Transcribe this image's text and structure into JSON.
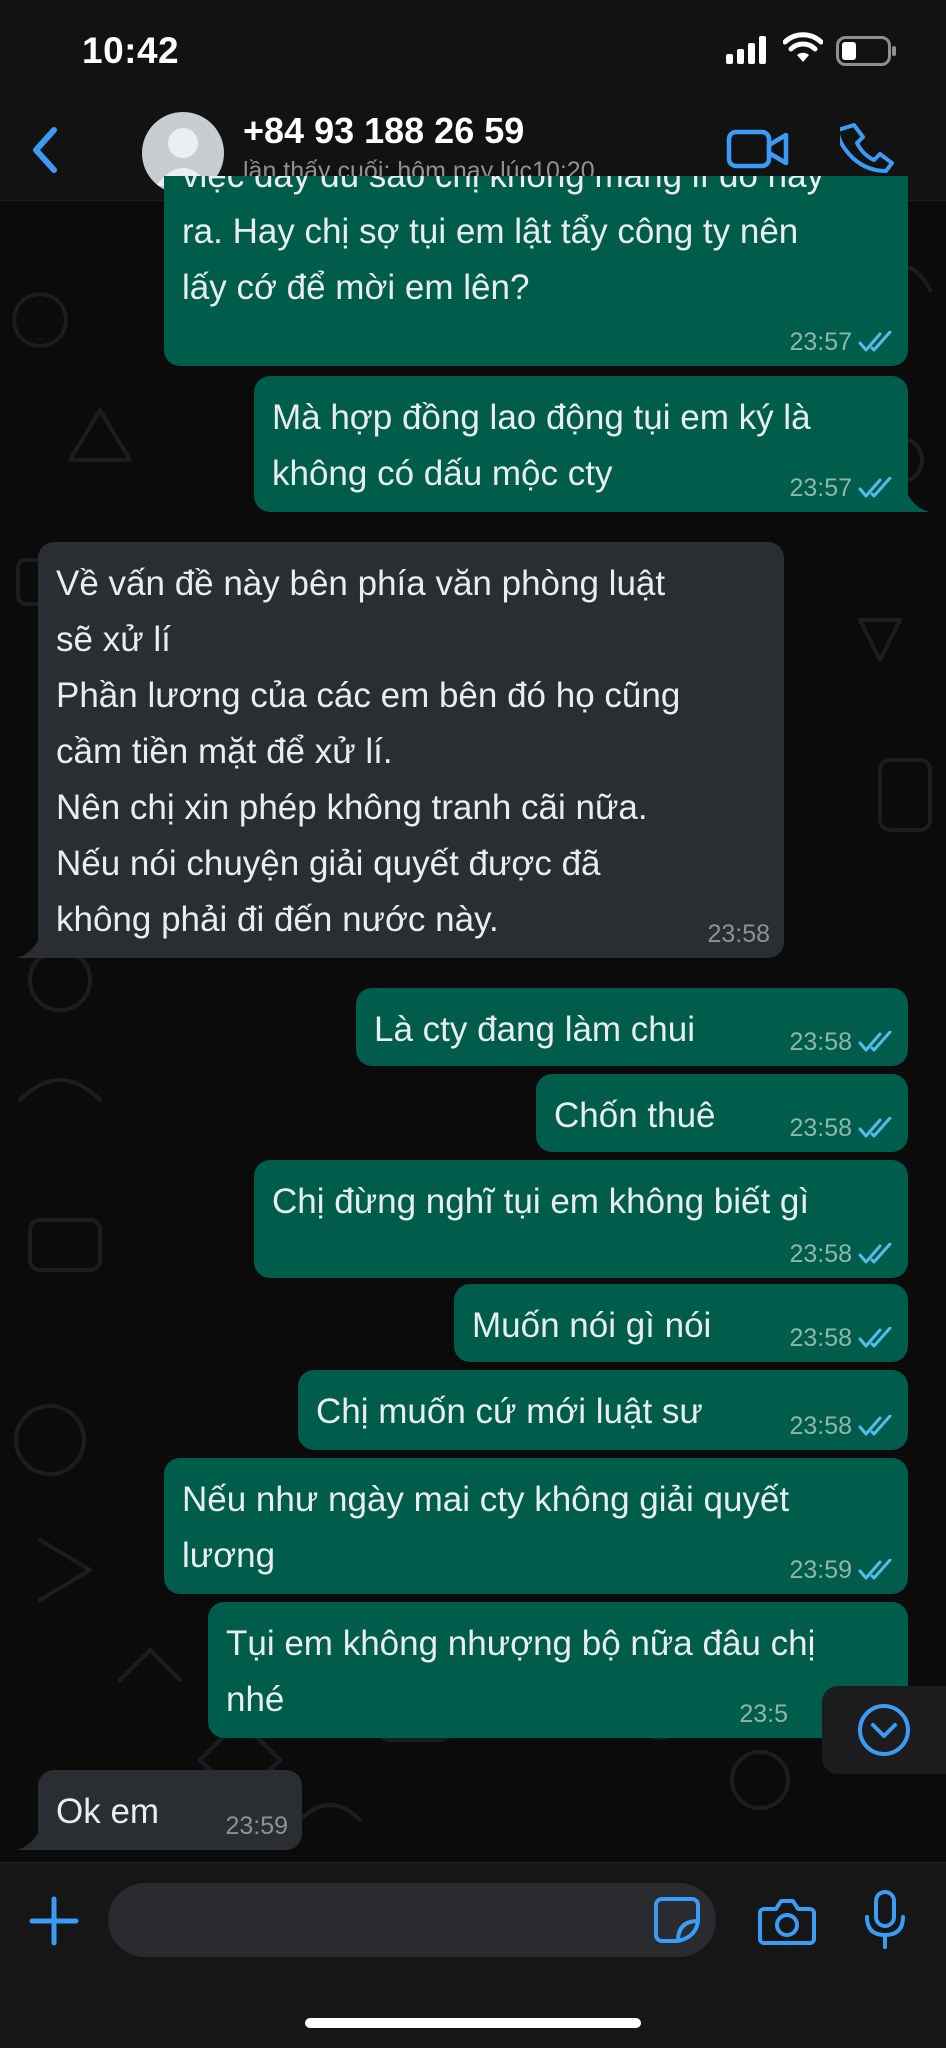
{
  "status_bar": {
    "time": "10:42"
  },
  "header": {
    "contact_name": "+84 93 188 26 59",
    "last_seen": "lần thấy cuối: hôm nay lúc10:20"
  },
  "colors": {
    "accent": "#3b9cf5",
    "outgoing_bubble": "#005c4b",
    "incoming_bubble": "#2a2d31",
    "read_ticks": "#53bdeb"
  },
  "messages": [
    {
      "direction": "out",
      "text": "việc đầy đủ sao chị không mang lí do hay\nra. Hay chị sợ tụi em lật tẩy công ty nên\nlấy cớ để mời em lên?",
      "time": "23:57",
      "status": "read"
    },
    {
      "direction": "out",
      "text": "Mà hợp đồng lao động tụi em ký là\nkhông có dấu mộc cty",
      "time": "23:57",
      "status": "read"
    },
    {
      "direction": "in",
      "text": "Về vấn đề này bên phía văn phòng luật\nsẽ xử lí\nPhần lương của các em bên đó họ cũng\ncầm tiền mặt để xử lí.\nNên chị xin phép không tranh cãi nữa.\nNếu nói chuyện giải quyết được đã\nkhông phải đi đến nước này.",
      "time": "23:58"
    },
    {
      "direction": "out",
      "text": "Là cty đang làm chui",
      "time": "23:58",
      "status": "read"
    },
    {
      "direction": "out",
      "text": "Chốn thuê",
      "time": "23:58",
      "status": "read"
    },
    {
      "direction": "out",
      "text": "Chị đừng nghĩ tụi em không biết gì",
      "time": "23:58",
      "status": "read"
    },
    {
      "direction": "out",
      "text": "Muốn nói gì nói",
      "time": "23:58",
      "status": "read"
    },
    {
      "direction": "out",
      "text": "Chị muốn cứ mới luật sư",
      "time": "23:58",
      "status": "read"
    },
    {
      "direction": "out",
      "text": "Nếu như ngày mai cty không giải quyết\nlương",
      "time": "23:59",
      "status": "read"
    },
    {
      "direction": "out",
      "text": "Tụi em không nhượng bộ nữa đâu chị\nnhé",
      "time": "23:5",
      "status": "read"
    },
    {
      "direction": "in",
      "text": "Ok em",
      "time": "23:59"
    }
  ],
  "input": {
    "value": "",
    "placeholder": ""
  }
}
